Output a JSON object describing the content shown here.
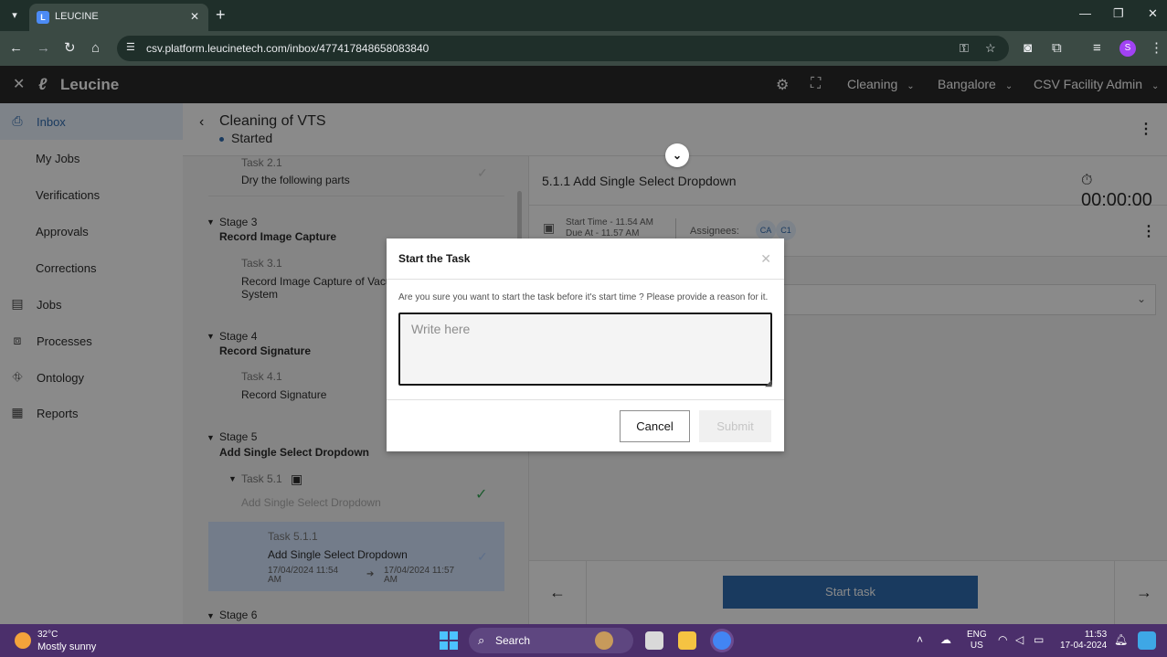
{
  "browser": {
    "tab_title": "LEUCINE",
    "url": "csv.platform.leucinetech.com/inbox/477417848658083840",
    "profile_initial": "S"
  },
  "app": {
    "logo_text": "Leucine",
    "header": {
      "use_case": "Cleaning",
      "facility": "Bangalore",
      "user": "CSV Facility Admin"
    }
  },
  "sidebar": {
    "items": [
      {
        "label": "Inbox",
        "icon": "inbox-icon",
        "active": true
      },
      {
        "label": "My Jobs"
      },
      {
        "label": "Verifications"
      },
      {
        "label": "Approvals"
      },
      {
        "label": "Corrections"
      },
      {
        "label": "Jobs",
        "icon": "clipboard-icon"
      },
      {
        "label": "Processes",
        "icon": "flow-icon"
      },
      {
        "label": "Ontology",
        "icon": "hierarchy-icon"
      },
      {
        "label": "Reports",
        "icon": "report-icon"
      }
    ]
  },
  "job": {
    "title": "Cleaning of VTS",
    "state": "Started"
  },
  "task_list": {
    "task_2_1_num": "Task 2.1",
    "task_2_1_name": "Dry the following parts",
    "stage3_num": "Stage 3",
    "stage3_name": "Record Image Capture",
    "task_3_1_num": "Task 3.1",
    "task_3_1_name_line1": "Record Image Capture of Vacu",
    "task_3_1_name_line2": "System",
    "stage4_num": "Stage 4",
    "stage4_name": "Record Signature",
    "task_4_1_num": "Task 4.1",
    "task_4_1_name": "Record Signature",
    "stage5_num": "Stage 5",
    "stage5_name": "Add Single Select Dropdown",
    "task_5_1_num": "Task 5.1",
    "task_5_1_name": "Add Single Select Dropdown",
    "task_5_1_1_num": "Task 5.1.1",
    "task_5_1_1_name": "Add Single Select Dropdown",
    "task_5_1_1_start_date": "17/04/2024 11:54",
    "task_5_1_1_start_ampm": "AM",
    "task_5_1_1_end_date": "17/04/2024 11:57",
    "task_5_1_1_end_ampm": "AM",
    "stage6_num": "Stage 6"
  },
  "task_detail": {
    "title": "5.1.1 Add Single Select Dropdown",
    "timer": "00:00:00",
    "start_time": "Start Time - 11.54 AM",
    "due_at": "Due At - 11.57 AM",
    "assignees_label": "Assignees:",
    "assignees": [
      "CA",
      "C1"
    ],
    "start_button": "Start task"
  },
  "modal": {
    "title": "Start the Task",
    "message": "Are you sure you want to start the task before it's start time ? Please provide a reason for it.",
    "placeholder": "Write here",
    "cancel": "Cancel",
    "submit": "Submit"
  },
  "taskbar": {
    "temperature": "32°C",
    "weather": "Mostly sunny",
    "search": "Search",
    "lang_line1": "ENG",
    "lang_line2": "US",
    "time": "11:53",
    "date": "17-04-2024"
  },
  "colors": {
    "primary": "#1d5ea8",
    "selected_bg": "#d0e2ff",
    "sidebar_active_bg": "#e7f1fd",
    "success": "#24a148"
  }
}
